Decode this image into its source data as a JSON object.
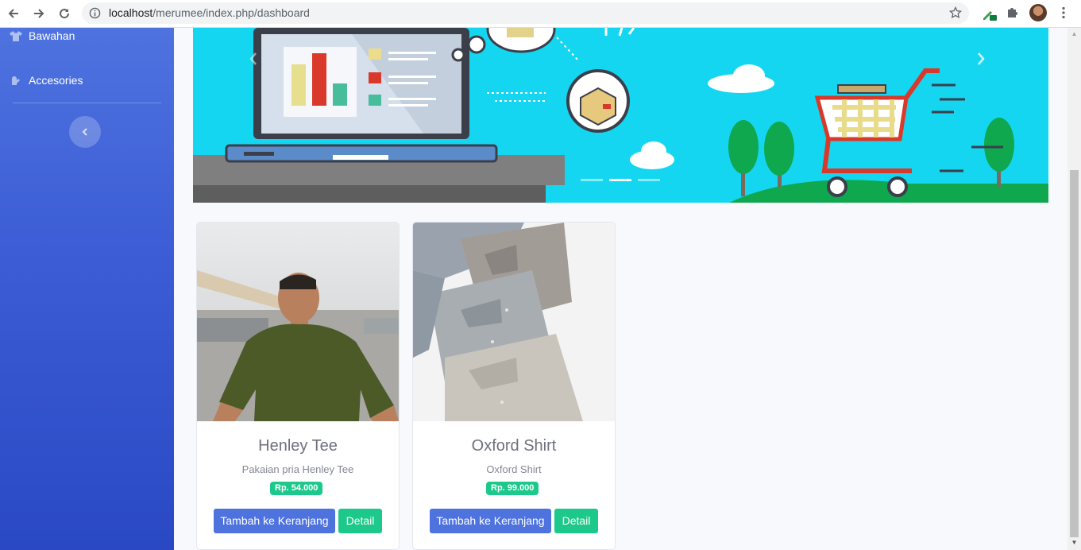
{
  "browser": {
    "url_host": "localhost",
    "url_path": "/merumee/index.php/dashboard"
  },
  "sidebar": {
    "items": [
      {
        "label": "Bawahan",
        "icon": "tshirt-icon"
      },
      {
        "label": "Accesories",
        "icon": "mitten-icon"
      }
    ],
    "toggle_icon": "chevron-left-icon"
  },
  "carousel": {
    "slides": 3,
    "active_slide": 2
  },
  "products": [
    {
      "name": "Henley Tee",
      "description": "Pakaian pria Henley Tee",
      "price": "Rp. 54.000",
      "cart_label": "Tambah ke Keranjang",
      "detail_label": "Detail"
    },
    {
      "name": "Oxford Shirt",
      "description": "Oxford Shirt",
      "price": "Rp. 99.000",
      "cart_label": "Tambah ke Keranjang",
      "detail_label": "Detail"
    }
  ],
  "colors": {
    "primary": "#4e73df",
    "success": "#1cc88a",
    "banner": "#14d6f0"
  }
}
